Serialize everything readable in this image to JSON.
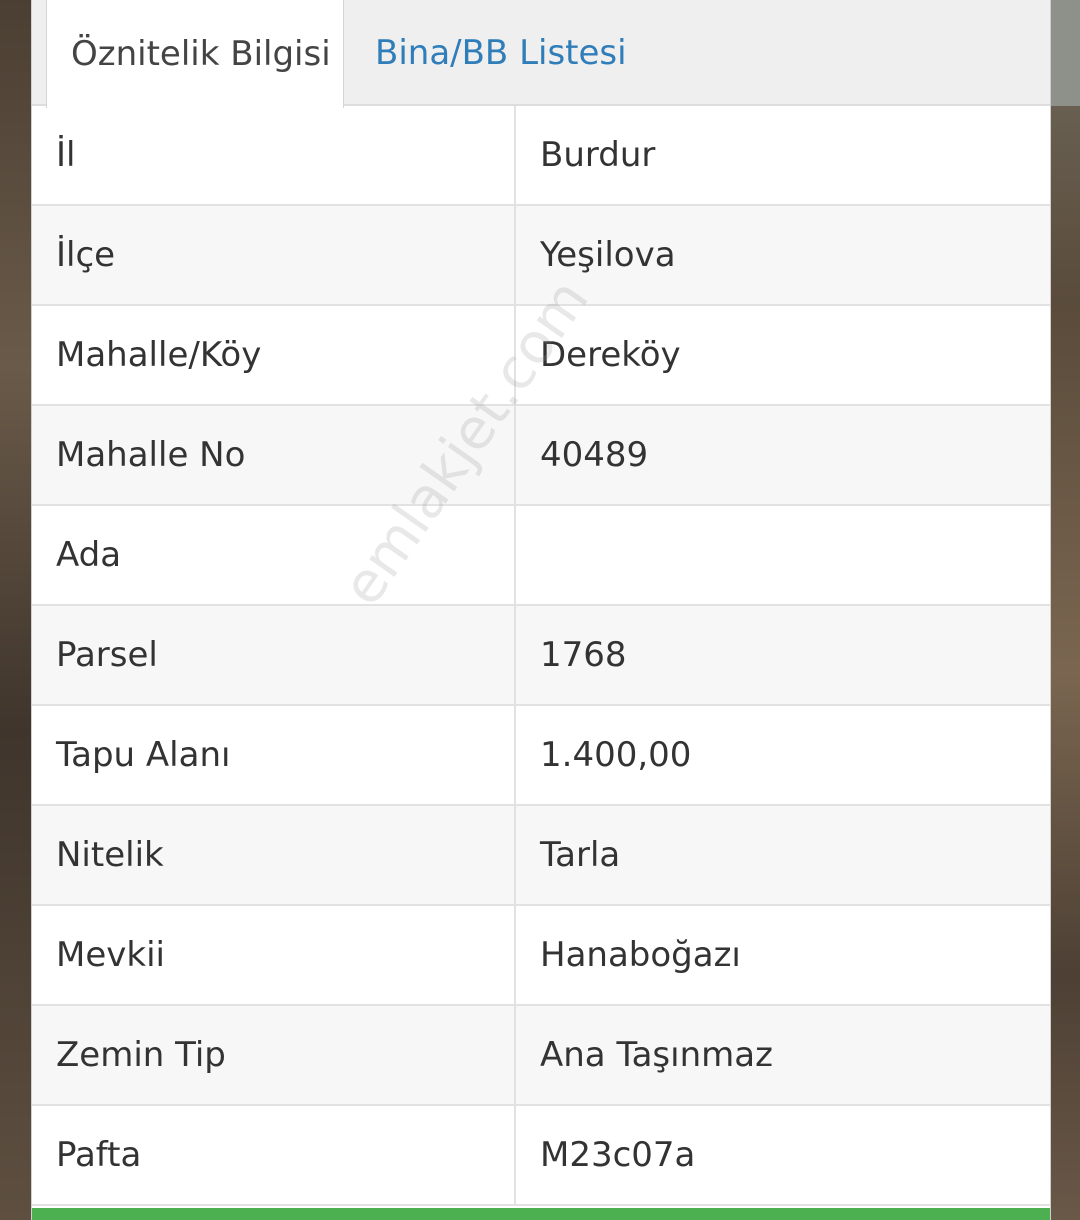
{
  "tabs": [
    {
      "label": "Öznitelik Bilgisi",
      "active": true
    },
    {
      "label": "Bina/BB Listesi",
      "active": false
    }
  ],
  "attributes": [
    {
      "key": "İl",
      "value": "Burdur"
    },
    {
      "key": "İlçe",
      "value": "Yeşilova"
    },
    {
      "key": "Mahalle/Köy",
      "value": "Dereköy"
    },
    {
      "key": "Mahalle No",
      "value": "40489"
    },
    {
      "key": "Ada",
      "value": ""
    },
    {
      "key": "Parsel",
      "value": "1768"
    },
    {
      "key": "Tapu Alanı",
      "value": "1.400,00"
    },
    {
      "key": "Nitelik",
      "value": "Tarla"
    },
    {
      "key": "Mevkii",
      "value": "Hanaboğazı"
    },
    {
      "key": "Zemin Tip",
      "value": "Ana Taşınmaz"
    },
    {
      "key": "Pafta",
      "value": "M23c07a"
    }
  ],
  "watermark": "emlakjet.com",
  "colors": {
    "tab_link": "#2f7db9",
    "bottom_bar": "#4caf50"
  }
}
